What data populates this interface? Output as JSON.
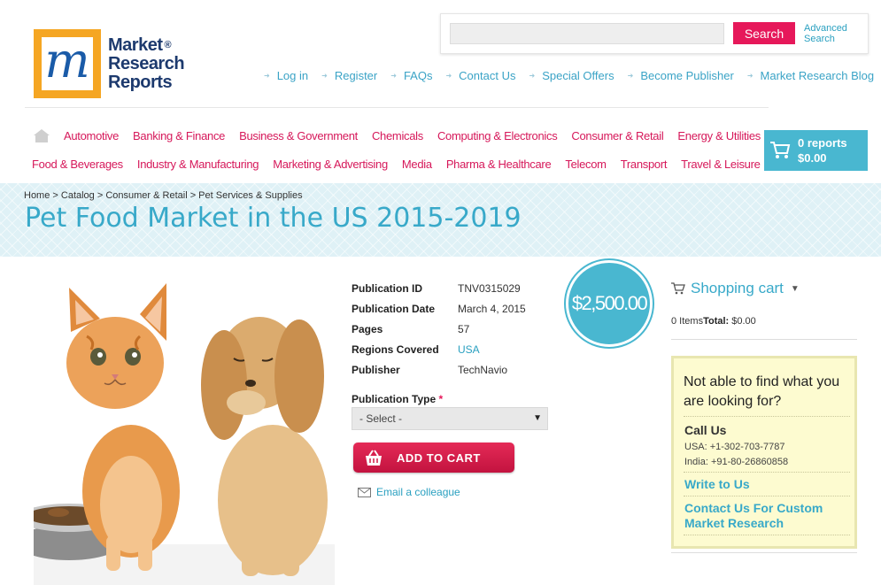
{
  "brand": {
    "line1": "Market",
    "line2": "Research",
    "line3": "Reports",
    "reg": "®"
  },
  "search": {
    "placeholder": "",
    "button": "Search",
    "advanced_line1": "Advanced",
    "advanced_line2": "Search"
  },
  "top_links": [
    "Log in",
    "Register",
    "FAQs",
    "Contact Us",
    "Special Offers",
    "Become Publisher",
    "Market Research Blog"
  ],
  "nav_row1": [
    "Automotive",
    "Banking & Finance",
    "Business & Government",
    "Chemicals",
    "Computing & Electronics",
    "Consumer & Retail",
    "Energy & Utilities"
  ],
  "nav_row2": [
    "Food & Beverages",
    "Industry & Manufacturing",
    "Marketing & Advertising",
    "Media",
    "Pharma & Healthcare",
    "Telecom",
    "Transport",
    "Travel & Leisure"
  ],
  "cart": {
    "reports": "0 reports",
    "total": "$0.00"
  },
  "breadcrumb": "Home > Catalog > Consumer & Retail > Pet Services & Supplies",
  "title": "Pet Food Market in the US 2015-2019",
  "details": {
    "publication_id_label": "Publication ID",
    "publication_id": "TNV0315029",
    "publication_date_label": "Publication Date",
    "publication_date": "March 4, 2015",
    "pages_label": "Pages",
    "pages": "57",
    "regions_label": "Regions Covered",
    "regions": "USA",
    "publisher_label": "Publisher",
    "publisher": "TechNavio"
  },
  "price": "$2,500.00",
  "publication_type": {
    "label": "Publication Type",
    "required_mark": "*",
    "selected": "- Select -"
  },
  "add_to_cart": "ADD TO CART",
  "email_colleague": "Email a colleague",
  "shopping_cart": {
    "heading": "Shopping cart",
    "items": "0 Items",
    "total_label": "Total:",
    "total": "$0.00"
  },
  "help": {
    "question": "Not able to find what you are looking for?",
    "call_us": "Call Us",
    "usa": "USA: +1-302-703-7787",
    "india": "India: +91-80-26860858",
    "write_to_us": "Write to Us",
    "contact_custom": "Contact Us For Custom Market Research"
  },
  "colors": {
    "accent_pink": "#e6185a",
    "accent_blue": "#49b7d0",
    "link_blue": "#38a9c9"
  }
}
